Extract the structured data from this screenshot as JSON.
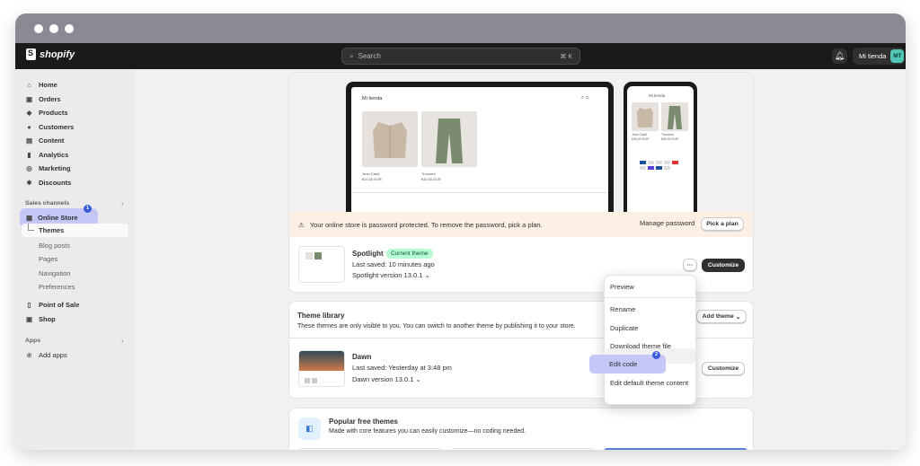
{
  "topbar": {
    "brand": "shopify",
    "search_placeholder": "Search",
    "search_shortcut": "⌘ K",
    "store_name": "Mi tienda",
    "avatar_initials": "MT"
  },
  "sidebar": {
    "items": [
      {
        "label": "Home",
        "icon": "home-icon",
        "glyph": "⌂"
      },
      {
        "label": "Orders",
        "icon": "orders-icon",
        "glyph": "▣"
      },
      {
        "label": "Products",
        "icon": "tag-icon",
        "glyph": "◆"
      },
      {
        "label": "Customers",
        "icon": "person-icon",
        "glyph": "●"
      },
      {
        "label": "Content",
        "icon": "content-icon",
        "glyph": "▤"
      },
      {
        "label": "Analytics",
        "icon": "bar-chart-icon",
        "glyph": "▮"
      },
      {
        "label": "Marketing",
        "icon": "target-icon",
        "glyph": "◎"
      },
      {
        "label": "Discounts",
        "icon": "discount-icon",
        "glyph": "✸"
      }
    ],
    "sales_channels_title": "Sales channels",
    "online_store_label": "Online Store",
    "online_store_badge": "1",
    "themes_label": "Themes",
    "sub_items": [
      "Blog posts",
      "Pages",
      "Navigation",
      "Preferences"
    ],
    "point_of_sale_label": "Point of Sale",
    "shop_label": "Shop",
    "apps_title": "Apps",
    "add_apps_label": "Add apps"
  },
  "preview": {
    "desktop_store_name": "Mi tienda",
    "phone_store_name": "Mi tienda",
    "products": [
      {
        "name": "Jean Cardi",
        "price": "€20,00 EUR"
      },
      {
        "name": "Trousers",
        "price": "€40,00 EUR"
      }
    ],
    "phone_products": [
      {
        "name": "Jean Cardi",
        "price": "€20,00 EUR"
      },
      {
        "name": "Trousers",
        "price": "€40,00 EUR"
      }
    ]
  },
  "warning": {
    "text": "Your online store is password protected. To remove the password, pick a plan.",
    "manage_password": "Manage password",
    "pick_plan": "Pick a plan"
  },
  "current_theme": {
    "name": "Spotlight",
    "badge": "Current theme",
    "last_saved": "Last saved: 10 minutes ago",
    "version": "Spotlight version 13.0.1",
    "customize": "Customize",
    "more": "···"
  },
  "theme_library": {
    "title": "Theme library",
    "description": "These themes are only visible to you. You can switch to another theme by publishing it to your store.",
    "add_theme": "Add theme",
    "theme": {
      "name": "Dawn",
      "last_saved": "Last saved: Yesterday at 3:48 pm",
      "version": "Dawn version 13.0.1",
      "customize": "Customize"
    }
  },
  "dropdown": {
    "items": [
      "Preview",
      "Rename",
      "Duplicate",
      "Download theme file",
      "Edit code",
      "Edit default theme content"
    ],
    "edit_code_badge": "2"
  },
  "popular": {
    "title": "Popular free themes",
    "description": "Made with core features you can easily customize—no coding needed."
  }
}
